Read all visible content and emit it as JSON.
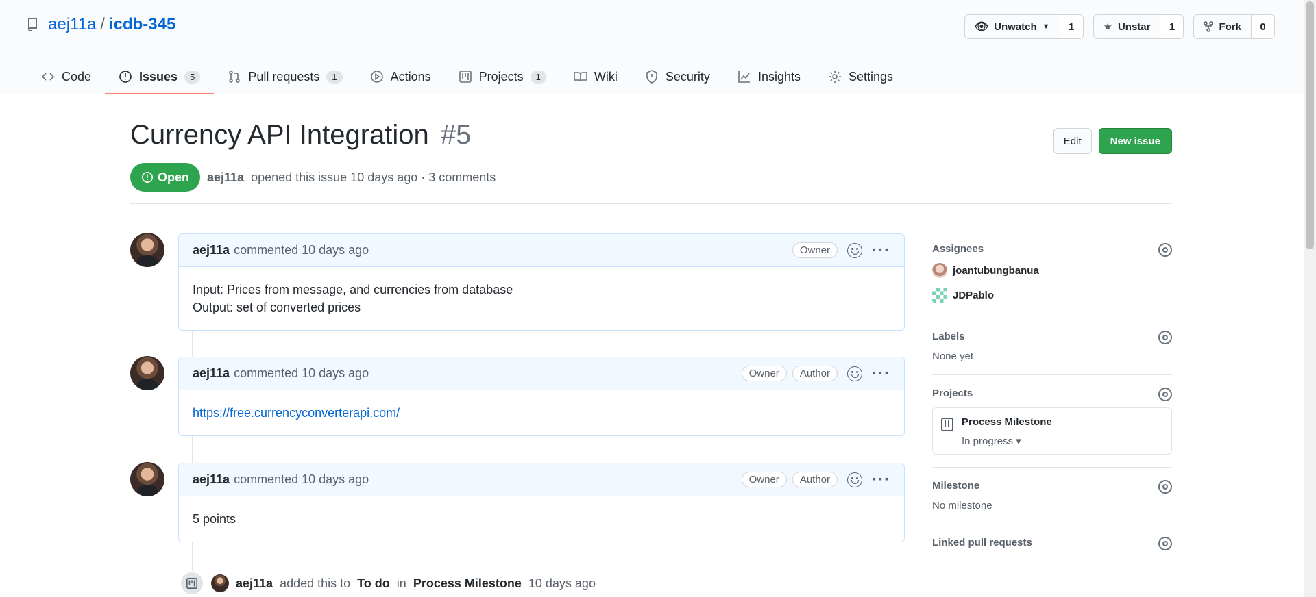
{
  "repo": {
    "owner": "aej11a",
    "name": "icdb-345",
    "separator": "/"
  },
  "repo_actions": {
    "watch_label": "Unwatch",
    "watch_count": "1",
    "star_label": "Unstar",
    "star_count": "1",
    "fork_label": "Fork",
    "fork_count": "0"
  },
  "tabs": [
    {
      "label": "Code",
      "count": null
    },
    {
      "label": "Issues",
      "count": "5"
    },
    {
      "label": "Pull requests",
      "count": "1"
    },
    {
      "label": "Actions",
      "count": null
    },
    {
      "label": "Projects",
      "count": "1"
    },
    {
      "label": "Wiki",
      "count": null
    },
    {
      "label": "Security",
      "count": null
    },
    {
      "label": "Insights",
      "count": null
    },
    {
      "label": "Settings",
      "count": null
    }
  ],
  "issue": {
    "title": "Currency API Integration",
    "number": "#5",
    "edit_label": "Edit",
    "new_issue_label": "New issue",
    "state": "Open",
    "author": "aej11a",
    "meta": "opened this issue 10 days ago · 3 comments"
  },
  "comments": [
    {
      "author": "aej11a",
      "action": "commented 10 days ago",
      "badges": [
        "Owner"
      ],
      "lines": [
        "Input: Prices from message, and currencies from database",
        "Output: set of converted prices"
      ]
    },
    {
      "author": "aej11a",
      "action": "commented 10 days ago",
      "badges": [
        "Owner",
        "Author"
      ],
      "link": "https://free.currencyconverterapi.com/"
    },
    {
      "author": "aej11a",
      "action": "commented 10 days ago",
      "badges": [
        "Owner",
        "Author"
      ],
      "lines": [
        "5 points"
      ]
    }
  ],
  "event": {
    "actor": "aej11a",
    "text1": "added this to",
    "column": "To do",
    "text2": "in",
    "project": "Process Milestone",
    "time": "10 days ago"
  },
  "sidebar": {
    "assignees_title": "Assignees",
    "assignees": [
      "joantubungbanua",
      "JDPablo"
    ],
    "labels_title": "Labels",
    "labels_value": "None yet",
    "projects_title": "Projects",
    "project_name": "Process Milestone",
    "project_status": "In progress ▾",
    "milestone_title": "Milestone",
    "milestone_value": "No milestone",
    "linked_title": "Linked pull requests"
  }
}
